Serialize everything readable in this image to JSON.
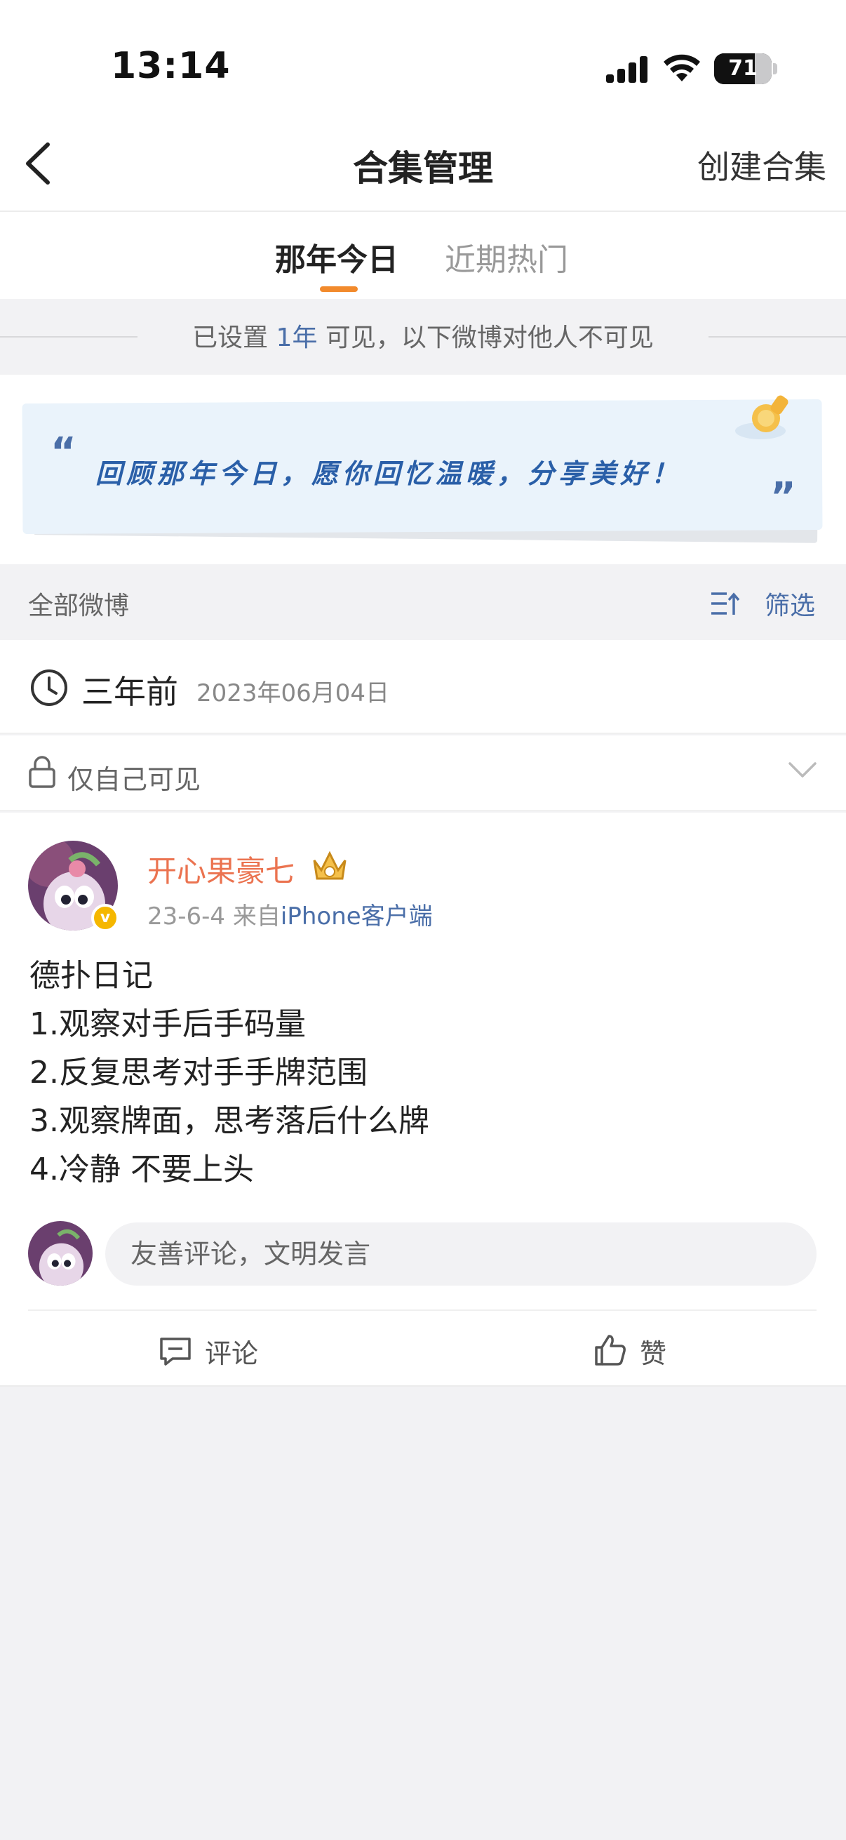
{
  "status": {
    "time": "13:14",
    "battery": "71",
    "battery_level": 0.71
  },
  "nav": {
    "title": "合集管理",
    "create": "创建合集"
  },
  "tabs": [
    {
      "label": "那年今日",
      "active": true
    },
    {
      "label": "近期热门",
      "active": false
    }
  ],
  "notice": {
    "prefix": "已设置 ",
    "highlight": "1年",
    "suffix": " 可见，以下微博对他人不可见"
  },
  "banner": {
    "open_quote": "“",
    "close_quote": "”",
    "slogan": "回顾那年今日，愿你回忆温暖，分享美好！"
  },
  "filter": {
    "all": "全部微博",
    "filter_label": "筛选"
  },
  "date_group": {
    "ago": "三年前",
    "date": "2023年06月04日"
  },
  "privacy": {
    "label": "仅自己可见"
  },
  "post": {
    "author": "开心果豪七",
    "verified_badge": "v",
    "time": "23-6-4",
    "from_prefix": "来自",
    "source": "iPhone客户端",
    "lines": [
      "德扑日记",
      "1.观察对手后手码量",
      "2.反复思考对手手牌范围",
      "3.观察牌面，思考落后什么牌",
      "4.冷静 不要上头"
    ],
    "comment_placeholder": "友善评论，文明发言",
    "actions": {
      "comment": "评论",
      "like": "赞"
    }
  },
  "colors": {
    "accent": "#f28a2c",
    "link": "#4a6ea8",
    "username": "#eb7350",
    "verified": "#f5b700"
  },
  "icons": [
    "back-icon",
    "signal-icon",
    "wifi-icon",
    "battery-icon",
    "pushpin-icon",
    "filter-icon",
    "clock-icon",
    "lock-icon",
    "chevron-down-icon",
    "crown-icon",
    "comment-icon",
    "thumbs-up-icon"
  ]
}
